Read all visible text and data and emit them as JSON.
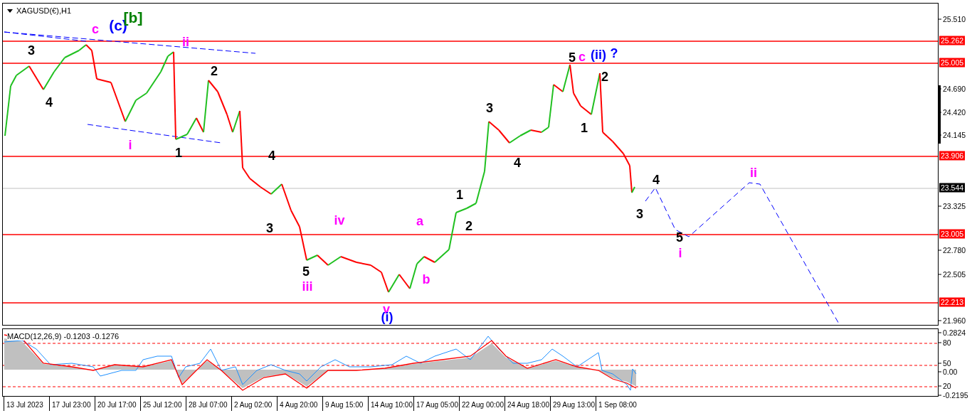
{
  "chart": {
    "title": "XAGUSD(€),H1",
    "wave_labels": [
      {
        "text": "c",
        "color": "#ff00ff"
      },
      {
        "text": "(c)",
        "color": "#0000ff"
      },
      {
        "text": "[b]",
        "color": "#008000"
      },
      {
        "text": "ii",
        "color": "#ff00ff"
      },
      {
        "text": "3",
        "color": "#000000"
      },
      {
        "text": "4",
        "color": "#000000"
      },
      {
        "text": "i",
        "color": "#ff00ff"
      },
      {
        "text": "1",
        "color": "#000000"
      },
      {
        "text": "2",
        "color": "#000000"
      },
      {
        "text": "4",
        "color": "#000000"
      },
      {
        "text": "3",
        "color": "#000000"
      },
      {
        "text": "iv",
        "color": "#ff00ff"
      },
      {
        "text": "5",
        "color": "#000000"
      },
      {
        "text": "iii",
        "color": "#ff00ff"
      },
      {
        "text": "a",
        "color": "#ff00ff"
      },
      {
        "text": "b",
        "color": "#ff00ff"
      },
      {
        "text": "v",
        "color": "#ff00ff"
      },
      {
        "text": "(i)",
        "color": "#0000ff"
      },
      {
        "text": "1",
        "color": "#000000"
      },
      {
        "text": "2",
        "color": "#000000"
      },
      {
        "text": "3",
        "color": "#000000"
      },
      {
        "text": "4",
        "color": "#000000"
      },
      {
        "text": "5",
        "color": "#000000"
      },
      {
        "text": "c",
        "color": "#ff00ff"
      },
      {
        "text": "(ii)",
        "color": "#0000ff"
      },
      {
        "text": "?",
        "color": "#0000ff"
      },
      {
        "text": "2",
        "color": "#000000"
      },
      {
        "text": "1",
        "color": "#000000"
      },
      {
        "text": "4",
        "color": "#000000"
      },
      {
        "text": "3",
        "color": "#000000"
      },
      {
        "text": "5",
        "color": "#000000"
      },
      {
        "text": "i",
        "color": "#ff00ff"
      },
      {
        "text": "ii",
        "color": "#ff00ff"
      }
    ],
    "levels": [
      {
        "label": "25.262"
      },
      {
        "label": "25.005"
      },
      {
        "label": "23.906"
      },
      {
        "label": "23.005"
      },
      {
        "label": "22.213"
      }
    ],
    "current_price": "23.544",
    "price_ticks": [
      "25.510",
      "24.690",
      "24.420",
      "24.145",
      "23.325",
      "22.780",
      "22.505",
      "21.960"
    ]
  },
  "indicator": {
    "title": "MACD(12,26,9) -0.1203 -0.1276",
    "axis_labels": [
      "0.2824",
      "80",
      "50",
      "0.00",
      "20",
      "-0.2195"
    ]
  },
  "time_axis": [
    "13 Jul 2023",
    "17 Jul 23:00",
    "20 Jul 17:00",
    "25 Jul 12:00",
    "28 Jul 07:00",
    "2 Aug 02:00",
    "4 Aug 20:00",
    "9 Aug 15:00",
    "14 Aug 10:00",
    "17 Aug 05:00",
    "22 Aug 00:00",
    "24 Aug 18:00",
    "29 Aug 13:00",
    "1 Sep 08:00"
  ]
}
